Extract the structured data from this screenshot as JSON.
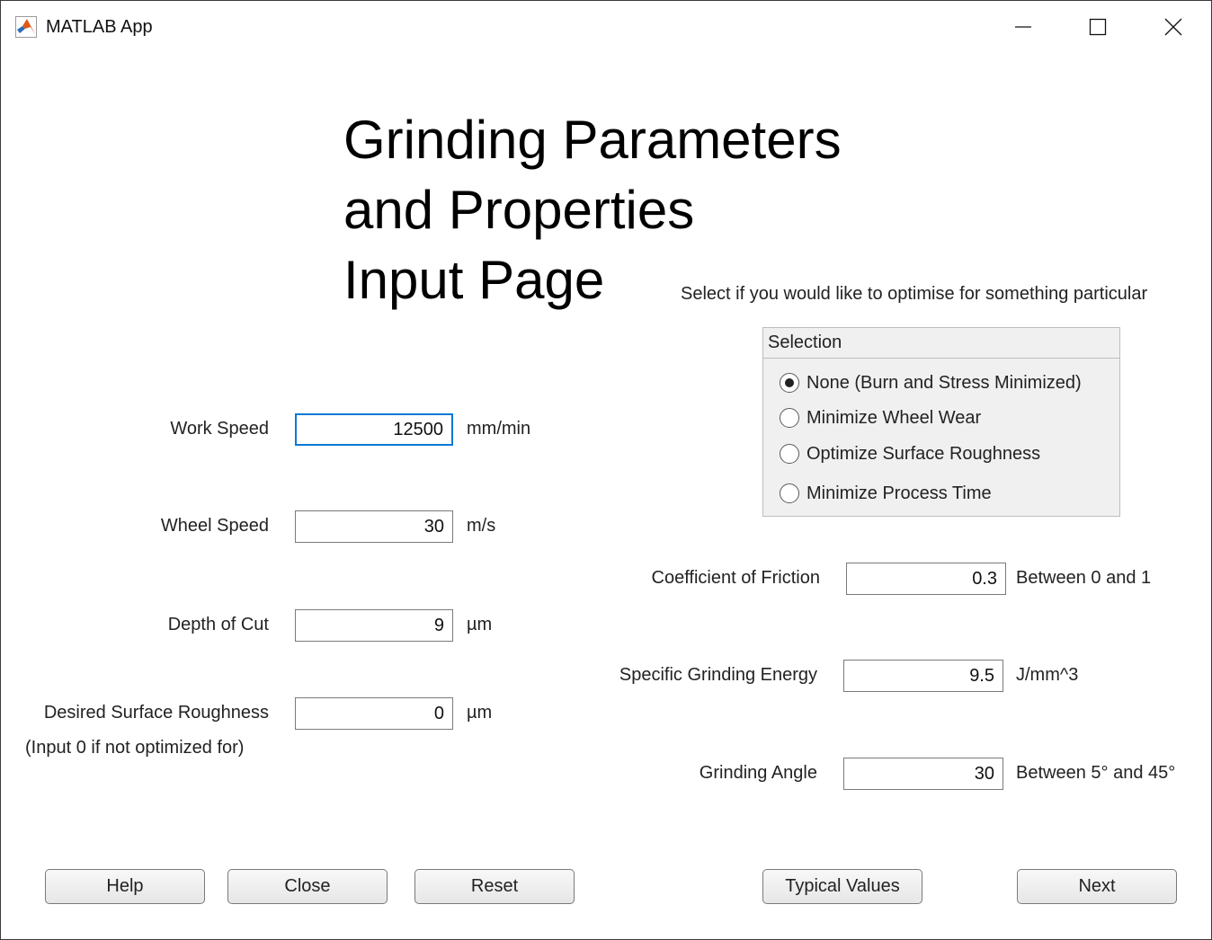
{
  "window": {
    "title": "MATLAB App",
    "icon": "matlab-logo-icon",
    "controls": [
      "minimize-icon",
      "maximize-icon",
      "close-icon"
    ]
  },
  "header": {
    "title_lines": [
      "Grinding Parameters",
      "and Properties",
      "Input Page"
    ]
  },
  "left_fields": [
    {
      "label": "Work Speed",
      "value": "12500",
      "unit": "mm/min",
      "focused": true
    },
    {
      "label": "Wheel Speed",
      "value": "30",
      "unit": "m/s"
    },
    {
      "label": "Depth of Cut",
      "value": "9",
      "unit": "µm"
    },
    {
      "label": "Desired Surface Roughness",
      "value": "0",
      "unit": "µm"
    }
  ],
  "roughness_note": "(Input 0 if not optimized for)",
  "optimise_prompt": "Select if you would like to optimise for something particular",
  "selection": {
    "title": "Selection",
    "options": [
      "None (Burn and Stress Minimized)",
      "Minimize Wheel Wear",
      "Optimize Surface Roughness",
      "Minimize Process Time"
    ],
    "selected_index": 0
  },
  "right_fields": [
    {
      "label": "Coefficient of Friction",
      "value": "0.3",
      "unit": "Between 0 and 1"
    },
    {
      "label": "Specific Grinding Energy",
      "value": "9.5",
      "unit": "J/mm^3"
    },
    {
      "label": "Grinding Angle",
      "value": "30",
      "unit": "Between 5° and 45°"
    }
  ],
  "buttons": {
    "help": "Help",
    "close": "Close",
    "reset": "Reset",
    "typical_values": "Typical Values",
    "next": "Next"
  },
  "colors": {
    "focus_border": "#0a78d7",
    "panel_background": "#f0f0f0"
  }
}
